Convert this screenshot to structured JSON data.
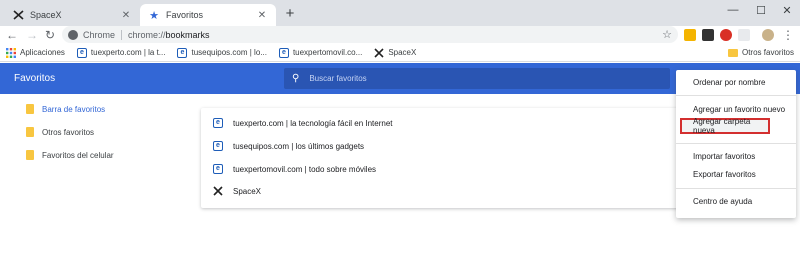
{
  "tabs": [
    {
      "title": "SpaceX",
      "active": false
    },
    {
      "title": "Favoritos",
      "active": true
    }
  ],
  "toolbar": {
    "chip": "Chrome",
    "url_scheme": "chrome://",
    "url_path": "bookmarks"
  },
  "bookmarks_bar": {
    "items": [
      {
        "label": "Aplicaciones",
        "icon": "apps-grid-icon"
      },
      {
        "label": "tuexperto.com | la t...",
        "icon": "site-icon"
      },
      {
        "label": "tusequipos.com | lo...",
        "icon": "site-icon"
      },
      {
        "label": "tuexpertomovil.co...",
        "icon": "site-icon"
      },
      {
        "label": "SpaceX",
        "icon": "spacex-icon"
      }
    ],
    "other": "Otros favoritos"
  },
  "header": {
    "title": "Favoritos",
    "search_placeholder": "Buscar favoritos"
  },
  "sidebar": {
    "items": [
      {
        "label": "Barra de favoritos",
        "active": true
      },
      {
        "label": "Otros favoritos",
        "active": false
      },
      {
        "label": "Favoritos del celular",
        "active": false
      }
    ]
  },
  "list": {
    "rows": [
      {
        "label": "tuexperto.com | la tecnología fácil en Internet",
        "icon": "site-icon"
      },
      {
        "label": "tusequipos.com | los últimos gadgets",
        "icon": "site-icon"
      },
      {
        "label": "tuexpertomovil.com | todo sobre móviles",
        "icon": "site-icon"
      },
      {
        "label": "SpaceX",
        "icon": "spacex-icon"
      }
    ]
  },
  "menu": {
    "sort": "Ordenar por nombre",
    "add_bookmark": "Agregar un favorito nuevo",
    "add_folder": "Agregar carpeta nueva",
    "import": "Importar favoritos",
    "export": "Exportar favoritos",
    "help": "Centro de ayuda"
  },
  "colors": {
    "header_blue": "#3367d6",
    "highlight_red": "#d32f2f",
    "folder_yellow": "#f8c640"
  }
}
